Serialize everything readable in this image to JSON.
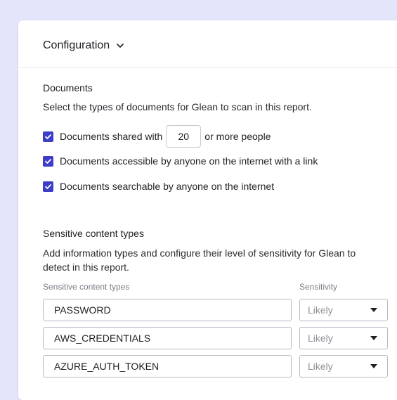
{
  "header": {
    "title": "Configuration"
  },
  "documents": {
    "title": "Documents",
    "description": "Select the types of documents for Glean to scan in this report.",
    "options": [
      {
        "label_before": "Documents shared with",
        "value": "20",
        "label_after": "or more people",
        "checked": true
      },
      {
        "label": "Documents accessible by anyone on the internet with a link",
        "checked": true
      },
      {
        "label": "Documents searchable by anyone on the internet",
        "checked": true
      }
    ]
  },
  "sensitive": {
    "title": "Sensitive content types",
    "description": "Add information types and configure their level of sensitivity for Glean to detect in this report.",
    "col_type_label": "Sensitive content types",
    "col_sensitivity_label": "Sensitivity",
    "rows": [
      {
        "type": "PASSWORD",
        "sensitivity": "Likely"
      },
      {
        "type": "AWS_CREDENTIALS",
        "sensitivity": "Likely"
      },
      {
        "type": "AZURE_AUTH_TOKEN",
        "sensitivity": "Likely"
      }
    ]
  },
  "colors": {
    "background": "#e4e5fb",
    "checkbox": "#3d3dc8"
  }
}
